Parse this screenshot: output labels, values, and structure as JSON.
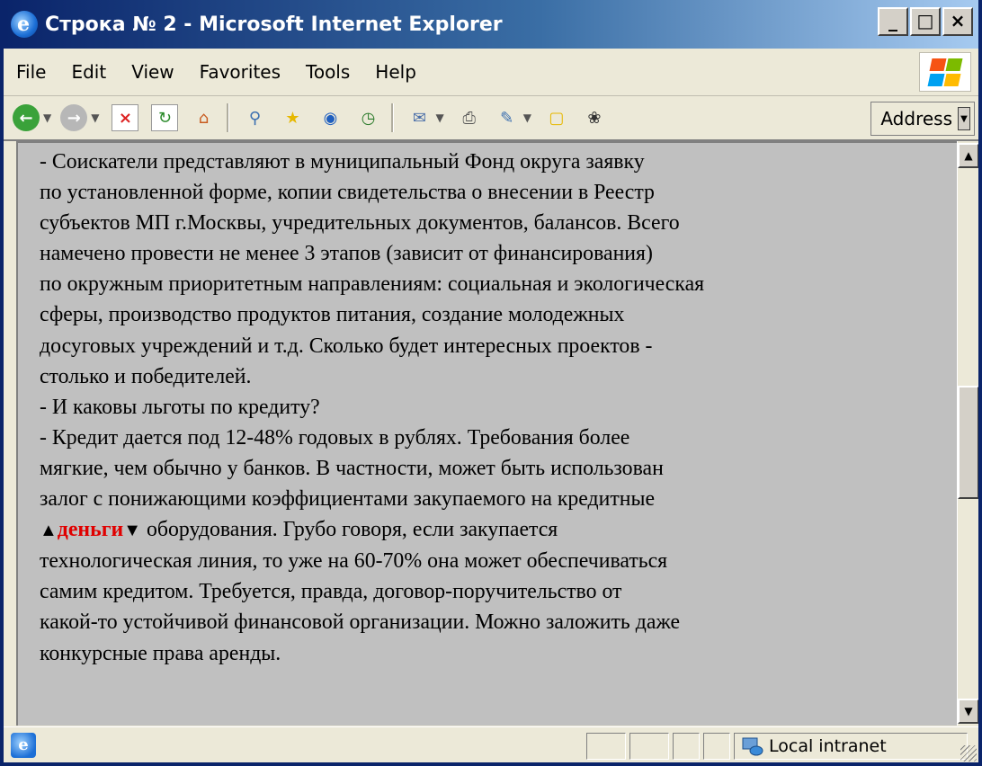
{
  "window": {
    "title": "Строка № 2 - Microsoft Internet Explorer",
    "controls": {
      "minimize": "_",
      "maximize": "□",
      "close": "×"
    }
  },
  "menu": {
    "items": [
      "File",
      "Edit",
      "View",
      "Favorites",
      "Tools",
      "Help"
    ]
  },
  "toolbar": {
    "icons": [
      "back-icon",
      "forward-icon",
      "stop-icon",
      "refresh-icon",
      "home-icon",
      "search-icon",
      "favorites-icon",
      "media-icon",
      "history-icon",
      "mail-icon",
      "print-icon",
      "edit-icon",
      "discuss-icon",
      "messenger-icon"
    ],
    "address_label": "Address"
  },
  "content": {
    "lines": [
      "- Соискатели представляют в муниципальный Фонд округа заявку",
      "по установленной форме, копии свидетельства о внесении в Реестр",
      "субъектов МП г.Москвы, учредительных документов, балансов. Всего",
      "намечено провести не менее 3 этапов (зависит от финансирования)",
      "по окружным приоритетным направлениям: социальная и экологическая",
      "сферы, производство продуктов питания, создание молодежных",
      "досуговых учреждений и т.д. Сколько будет интересных проектов -",
      "столько и победителей.",
      "- И каковы льготы по кредиту?",
      "- Кредит дается под 12-48% годовых в рублях. Требования более",
      "мягкие, чем обычно у банков. В частности, может быть использован",
      "залог с понижающими коэффициентами закупаемого на кредитные"
    ],
    "highlight_word": "деньги",
    "highlight_rest": " оборудования. Грубо говоря, если закупается",
    "lines_after": [
      "технологическая линия, то уже на 60-70% она может обеспечиваться",
      "самим кредитом. Требуется, правда, договор-поручительство от",
      "какой-то устойчивой финансовой организации. Можно заложить даже",
      "конкурсные права аренды."
    ]
  },
  "status": {
    "zone": "Local intranet"
  },
  "colors": {
    "highlight": "#e00000",
    "page_background": "#c0c0c0",
    "titlebar_start": "#0a246a"
  }
}
